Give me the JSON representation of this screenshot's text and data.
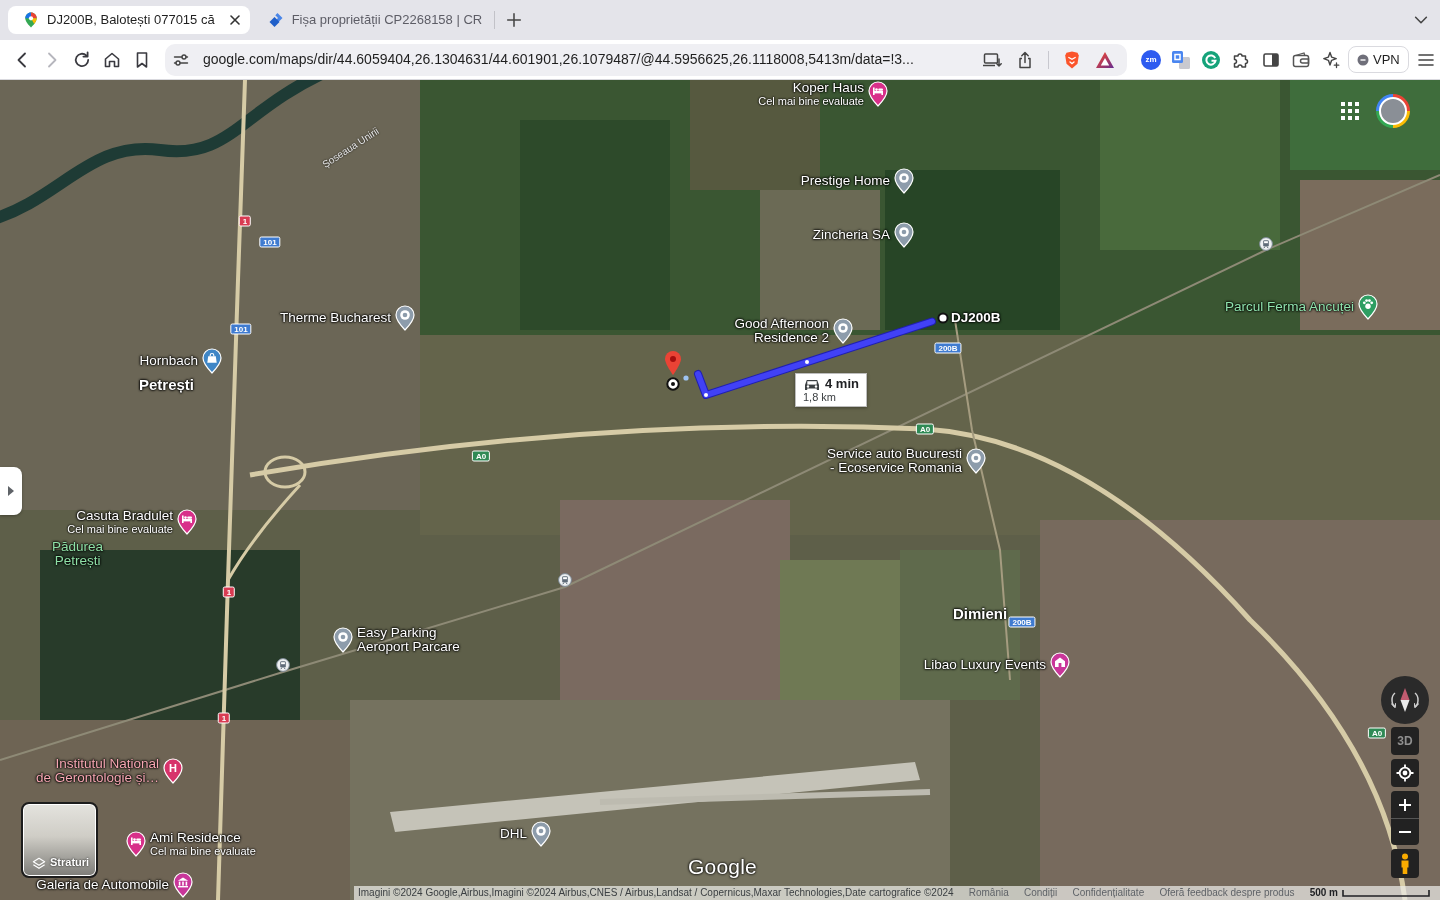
{
  "browser": {
    "tabs": [
      {
        "kind": "pin",
        "title": "DJ200B, Balotești 077015 că",
        "selected": true
      },
      {
        "kind": "diamond",
        "title": "Fișa proprietății CP2268158 | CR",
        "selected": false
      }
    ],
    "nav_buttons": [
      {
        "kind": "back",
        "disabled": false
      },
      {
        "kind": "forward",
        "disabled": true
      },
      {
        "kind": "reload",
        "disabled": false
      },
      {
        "kind": "home",
        "disabled": false
      },
      {
        "kind": "bookmark",
        "disabled": false
      }
    ],
    "address_bar": {
      "url": "google.com/maps/dir/44.6059404,26.1304631/44.601901,26.1079487/@44.5956625,26.1118008,5413m/data=!3..."
    },
    "extensions": [
      {
        "kind": "zm",
        "label": "zm"
      },
      {
        "kind": "translate"
      },
      {
        "kind": "grammar"
      },
      {
        "kind": "puzzle"
      },
      {
        "kind": "sidebar"
      },
      {
        "kind": "wallet"
      },
      {
        "kind": "sparkle"
      }
    ],
    "vpn_button": {
      "label": "VPN"
    }
  },
  "map": {
    "places": [
      {
        "kind": "hotel",
        "lines": [
          "Koper Haus"
        ],
        "note": "Cel mai bine evaluate"
      },
      {
        "kind": "place",
        "lines": [
          "Prestige Home"
        ]
      },
      {
        "kind": "place",
        "lines": [
          "Zincheria SA"
        ]
      },
      {
        "kind": "park",
        "lines": [
          "Parcul Ferma Ancuței"
        ]
      },
      {
        "kind": "place",
        "lines": [
          "Therme Bucharest"
        ]
      },
      {
        "kind": "place",
        "lines": [
          "Good Afternoon",
          "Residence 2"
        ]
      },
      {
        "kind": "shop",
        "lines": [
          "Hornbach"
        ]
      },
      {
        "kind": "town",
        "lines": [
          "Petrești"
        ]
      },
      {
        "kind": "place",
        "lines": [
          "Service auto Bucuresti",
          "- Ecoservice Romania"
        ]
      },
      {
        "kind": "hotel",
        "lines": [
          "Casuta Bradulet"
        ],
        "note": "Cel mai bine evaluate"
      },
      {
        "kind": "forest",
        "lines": [
          "Pădurea",
          "Petrești"
        ]
      },
      {
        "kind": "town",
        "lines": [
          "Dimieni"
        ]
      },
      {
        "kind": "place",
        "lines": [
          "Easy Parking",
          "Aeroport Parcare"
        ]
      },
      {
        "kind": "venue",
        "lines": [
          "Libao Luxury Events"
        ]
      },
      {
        "kind": "hospital",
        "lines": [
          "Institutul Național",
          "de Gerontologie și…"
        ],
        "symbol": "H"
      },
      {
        "kind": "hotel",
        "lines": [
          "Ami Residence"
        ],
        "note": "Cel mai bine evaluate"
      },
      {
        "kind": "place",
        "lines": [
          "DHL"
        ]
      },
      {
        "kind": "museum",
        "lines": [
          "Galeria de Automobile"
        ]
      }
    ],
    "road_labels": [
      {
        "name": "Șoseaua Unirii"
      }
    ],
    "road_shields": [
      {
        "number": "1",
        "color": "#d93b52"
      },
      {
        "number": "101",
        "color": "#3f7bd0"
      },
      {
        "number": "101",
        "color": "#3f7bd0"
      },
      {
        "number": "200B",
        "color": "#3f7bd0"
      },
      {
        "number": "A0",
        "color": "#2f8a55"
      },
      {
        "number": "A0",
        "color": "#2f8a55"
      },
      {
        "number": "1",
        "color": "#d93b52"
      },
      {
        "number": "200B",
        "color": "#3f7bd0"
      },
      {
        "number": "1",
        "color": "#d93b52"
      },
      {
        "number": "A0",
        "color": "#2f8a55"
      }
    ],
    "route": {
      "destination": "DJ200B",
      "duration": "4 min",
      "distance": "1,8 km"
    },
    "layers_button": {
      "label": "Straturi"
    },
    "map_controls": {
      "tilt_label": "3D"
    },
    "logo": "Google",
    "footer": {
      "attribution": "Imagini ©2024 Google,Airbus,Imagini ©2024 Airbus,CNES / Airbus,Landsat / Copernicus,Maxar Technologies,Date cartografice ©2024",
      "links": [
        "România",
        "Condiții",
        "Confidențialitate",
        "Oferă feedback despre produs"
      ],
      "scale": "500 m"
    }
  }
}
